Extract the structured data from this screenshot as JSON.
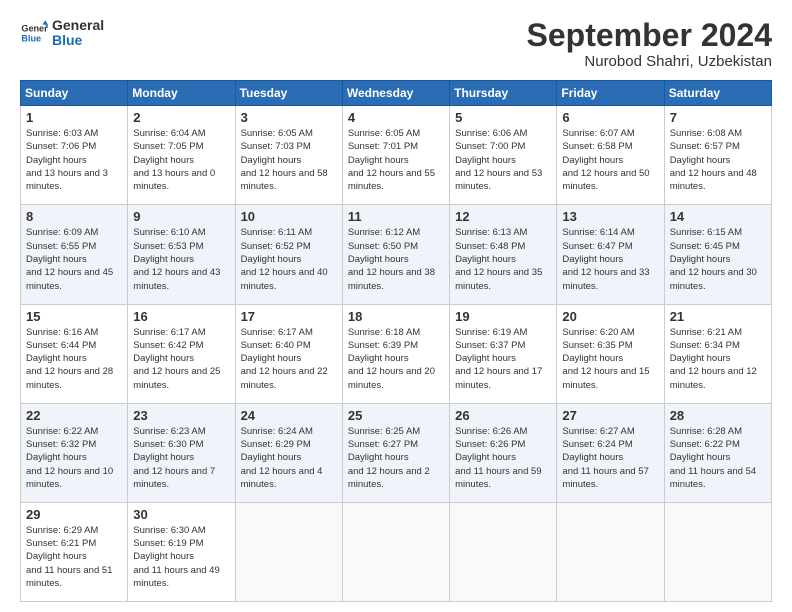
{
  "logo": {
    "line1": "General",
    "line2": "Blue"
  },
  "title": "September 2024",
  "location": "Nurobod Shahri, Uzbekistan",
  "headers": [
    "Sunday",
    "Monday",
    "Tuesday",
    "Wednesday",
    "Thursday",
    "Friday",
    "Saturday"
  ],
  "weeks": [
    [
      {
        "day": "1",
        "sunrise": "6:03 AM",
        "sunset": "7:06 PM",
        "daylight": "13 hours and 3 minutes."
      },
      {
        "day": "2",
        "sunrise": "6:04 AM",
        "sunset": "7:05 PM",
        "daylight": "13 hours and 0 minutes."
      },
      {
        "day": "3",
        "sunrise": "6:05 AM",
        "sunset": "7:03 PM",
        "daylight": "12 hours and 58 minutes."
      },
      {
        "day": "4",
        "sunrise": "6:05 AM",
        "sunset": "7:01 PM",
        "daylight": "12 hours and 55 minutes."
      },
      {
        "day": "5",
        "sunrise": "6:06 AM",
        "sunset": "7:00 PM",
        "daylight": "12 hours and 53 minutes."
      },
      {
        "day": "6",
        "sunrise": "6:07 AM",
        "sunset": "6:58 PM",
        "daylight": "12 hours and 50 minutes."
      },
      {
        "day": "7",
        "sunrise": "6:08 AM",
        "sunset": "6:57 PM",
        "daylight": "12 hours and 48 minutes."
      }
    ],
    [
      {
        "day": "8",
        "sunrise": "6:09 AM",
        "sunset": "6:55 PM",
        "daylight": "12 hours and 45 minutes."
      },
      {
        "day": "9",
        "sunrise": "6:10 AM",
        "sunset": "6:53 PM",
        "daylight": "12 hours and 43 minutes."
      },
      {
        "day": "10",
        "sunrise": "6:11 AM",
        "sunset": "6:52 PM",
        "daylight": "12 hours and 40 minutes."
      },
      {
        "day": "11",
        "sunrise": "6:12 AM",
        "sunset": "6:50 PM",
        "daylight": "12 hours and 38 minutes."
      },
      {
        "day": "12",
        "sunrise": "6:13 AM",
        "sunset": "6:48 PM",
        "daylight": "12 hours and 35 minutes."
      },
      {
        "day": "13",
        "sunrise": "6:14 AM",
        "sunset": "6:47 PM",
        "daylight": "12 hours and 33 minutes."
      },
      {
        "day": "14",
        "sunrise": "6:15 AM",
        "sunset": "6:45 PM",
        "daylight": "12 hours and 30 minutes."
      }
    ],
    [
      {
        "day": "15",
        "sunrise": "6:16 AM",
        "sunset": "6:44 PM",
        "daylight": "12 hours and 28 minutes."
      },
      {
        "day": "16",
        "sunrise": "6:17 AM",
        "sunset": "6:42 PM",
        "daylight": "12 hours and 25 minutes."
      },
      {
        "day": "17",
        "sunrise": "6:17 AM",
        "sunset": "6:40 PM",
        "daylight": "12 hours and 22 minutes."
      },
      {
        "day": "18",
        "sunrise": "6:18 AM",
        "sunset": "6:39 PM",
        "daylight": "12 hours and 20 minutes."
      },
      {
        "day": "19",
        "sunrise": "6:19 AM",
        "sunset": "6:37 PM",
        "daylight": "12 hours and 17 minutes."
      },
      {
        "day": "20",
        "sunrise": "6:20 AM",
        "sunset": "6:35 PM",
        "daylight": "12 hours and 15 minutes."
      },
      {
        "day": "21",
        "sunrise": "6:21 AM",
        "sunset": "6:34 PM",
        "daylight": "12 hours and 12 minutes."
      }
    ],
    [
      {
        "day": "22",
        "sunrise": "6:22 AM",
        "sunset": "6:32 PM",
        "daylight": "12 hours and 10 minutes."
      },
      {
        "day": "23",
        "sunrise": "6:23 AM",
        "sunset": "6:30 PM",
        "daylight": "12 hours and 7 minutes."
      },
      {
        "day": "24",
        "sunrise": "6:24 AM",
        "sunset": "6:29 PM",
        "daylight": "12 hours and 4 minutes."
      },
      {
        "day": "25",
        "sunrise": "6:25 AM",
        "sunset": "6:27 PM",
        "daylight": "12 hours and 2 minutes."
      },
      {
        "day": "26",
        "sunrise": "6:26 AM",
        "sunset": "6:26 PM",
        "daylight": "11 hours and 59 minutes."
      },
      {
        "day": "27",
        "sunrise": "6:27 AM",
        "sunset": "6:24 PM",
        "daylight": "11 hours and 57 minutes."
      },
      {
        "day": "28",
        "sunrise": "6:28 AM",
        "sunset": "6:22 PM",
        "daylight": "11 hours and 54 minutes."
      }
    ],
    [
      {
        "day": "29",
        "sunrise": "6:29 AM",
        "sunset": "6:21 PM",
        "daylight": "11 hours and 51 minutes."
      },
      {
        "day": "30",
        "sunrise": "6:30 AM",
        "sunset": "6:19 PM",
        "daylight": "11 hours and 49 minutes."
      },
      null,
      null,
      null,
      null,
      null
    ]
  ]
}
